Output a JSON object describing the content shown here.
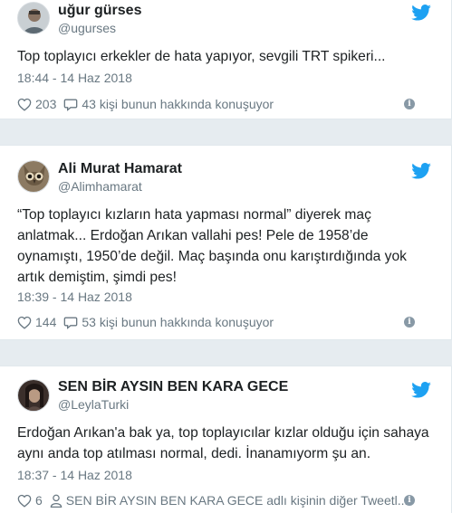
{
  "tweets": [
    {
      "name": "uğur gürses",
      "handle": "@ugurses",
      "text": "Top toplayıcı erkekler de hata yapıyor, sevgili TRT spikeri...",
      "time": "18:44 - 14 Haz 2018",
      "likes": "203",
      "talk": "43 kişi bunun hakkında konuşuyor",
      "avatar_icon": "person-avatar",
      "colors": {
        "avatar": "#7f8c94"
      }
    },
    {
      "name": "Ali Murat Hamarat",
      "handle": "@Alimhamarat",
      "text": "“Top toplayıcı kızların hata yapması normal” diyerek maç anlatmak... Erdoğan Arıkan vallahi pes! Pele de 1958’de oynamıştı, 1950’de değil. Maç başında onu karıştırdığında yok artık demiştim, şimdi pes!",
      "time": "18:39 - 14 Haz 2018",
      "likes": "144",
      "talk": "53 kişi bunun hakkında konuşuyor",
      "avatar_icon": "owl-avatar",
      "colors": {
        "avatar": "#6b5a44"
      }
    },
    {
      "name": "SEN BİR AYSIN BEN KARA GECE",
      "handle": "@LeylaTurki",
      "text": "Erdoğan Arıkan'a bak ya, top toplayıcılar kızlar olduğu için sahaya aynı anda top atılması normal, dedi. İnanamıyorm şu an.",
      "time": "18:37 - 14 Haz 2018",
      "likes": "6",
      "talk": "SEN BİR AYSIN BEN KARA GECE adlı kişinin diğer Tweetl...",
      "avatar_icon": "portrait-avatar",
      "colors": {
        "avatar": "#4a3b36"
      }
    }
  ],
  "colors": {
    "twitter_blue": "#1da1f2",
    "meta": "#697882",
    "text": "#1c2022"
  },
  "icons": [
    "twitter-bird-icon",
    "heart-icon",
    "comment-icon",
    "person-icon",
    "info-icon"
  ]
}
